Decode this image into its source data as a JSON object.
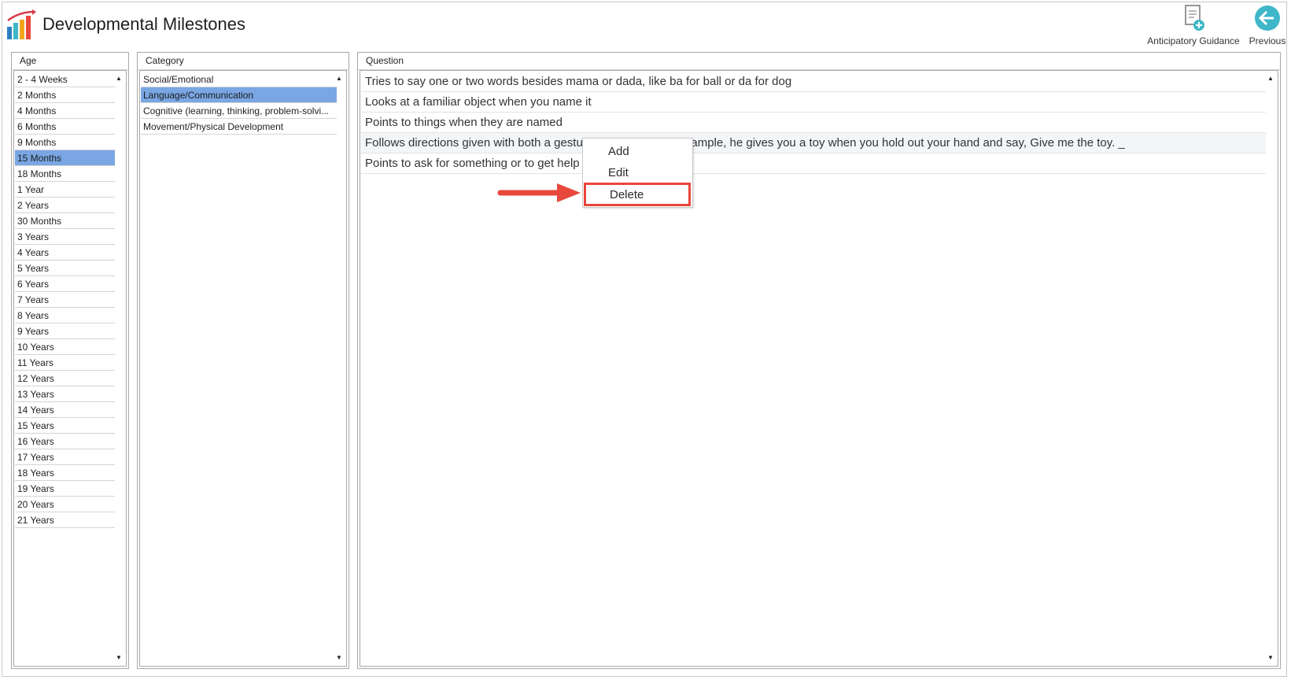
{
  "header": {
    "title": "Developmental Milestones",
    "logo_icon": "bar-chart-growth-icon",
    "buttons": [
      {
        "label": "Anticipatory Guidance",
        "icon": "document-add-icon"
      },
      {
        "label": "Previous",
        "icon": "back-arrow-circle-icon"
      }
    ]
  },
  "age_panel": {
    "header": "Age",
    "selected": "15 Months",
    "items": [
      "2 - 4 Weeks",
      "2 Months",
      "4 Months",
      "6 Months",
      "9 Months",
      "15 Months",
      "18 Months",
      "1 Year",
      "2 Years",
      "30 Months",
      "3 Years",
      "4 Years",
      "5 Years",
      "6 Years",
      "7 Years",
      "8 Years",
      "9 Years",
      "10 Years",
      "11 Years",
      "12 Years",
      "13 Years",
      "14 Years",
      "15 Years",
      "16 Years",
      "17 Years",
      "18 Years",
      "19 Years",
      "20 Years",
      "21 Years"
    ]
  },
  "category_panel": {
    "header": "Category",
    "selected": "Language/Communication",
    "items": [
      "Social/Emotional",
      "Language/Communication",
      "Cognitive (learning, thinking, problem-solvi...",
      "Movement/Physical Development"
    ]
  },
  "question_panel": {
    "header": "Question",
    "items": [
      "Tries to say one or two words besides mama or dada, like ba for ball or da for dog",
      "Looks at a familiar object when you name it",
      "Points to things when they are named",
      "Follows directions given with both a gesture and words. For example, he gives you a toy when you hold out your hand and say, Give me the toy. _",
      "Points to ask for something or to get help"
    ]
  },
  "context_menu": {
    "items": [
      "Add",
      "Edit",
      "Delete"
    ],
    "highlighted": "Delete"
  },
  "colors": {
    "selection": "#7aa7e3",
    "callout": "#e8473b",
    "accent_teal": "#3fb7c9"
  }
}
